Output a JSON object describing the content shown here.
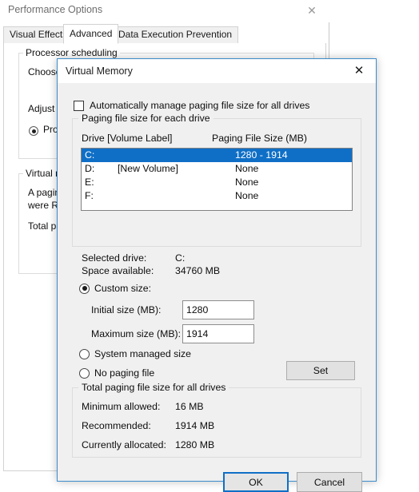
{
  "background_window": {
    "title": "Performance Options",
    "close_icon": "close-icon",
    "tabs": [
      {
        "label": "Visual Effects",
        "active": false
      },
      {
        "label": "Advanced",
        "active": true
      },
      {
        "label": "Data Execution Prevention",
        "active": false
      }
    ],
    "processor_group": {
      "title": "Processor scheduling",
      "line1": "Choose",
      "line2": "Adjust f",
      "radio_label": "Prog"
    },
    "virtual_memory_group": {
      "title": "Virtual m",
      "line1": "A pagin",
      "line2": "were RA",
      "line3": "Total pa"
    }
  },
  "dialog": {
    "title": "Virtual Memory",
    "close_icon": "close-icon",
    "auto_manage": {
      "label": "Automatically manage paging file size for all drives",
      "checked": false
    },
    "each_drive_group": {
      "title": "Paging file size for each drive",
      "columns": {
        "drive": "Drive  [Volume Label]",
        "size": "Paging File Size (MB)"
      },
      "rows": [
        {
          "drive": "C:",
          "volume_label": "",
          "size": "1280 - 1914",
          "selected": true
        },
        {
          "drive": "D:",
          "volume_label": "[New Volume]",
          "size": "None",
          "selected": false
        },
        {
          "drive": "E:",
          "volume_label": "",
          "size": "None",
          "selected": false
        },
        {
          "drive": "F:",
          "volume_label": "",
          "size": "None",
          "selected": false
        }
      ]
    },
    "selected_drive": {
      "drive_label": "Selected drive:",
      "drive_value": "C:",
      "space_label": "Space available:",
      "space_value": "34760 MB"
    },
    "size_options": {
      "custom": {
        "label": "Custom size:",
        "checked": true
      },
      "system_managed": {
        "label": "System managed size",
        "checked": false
      },
      "no_paging": {
        "label": "No paging file",
        "checked": false
      },
      "initial_label": "Initial size (MB):",
      "initial_value": "1280",
      "maximum_label": "Maximum size (MB):",
      "maximum_value": "1914",
      "set_label": "Set"
    },
    "total_group": {
      "title": "Total paging file size for all drives",
      "rows": [
        {
          "label": "Minimum allowed:",
          "value": "16 MB"
        },
        {
          "label": "Recommended:",
          "value": "1914 MB"
        },
        {
          "label": "Currently allocated:",
          "value": "1280 MB"
        }
      ]
    },
    "footer": {
      "ok_label": "OK",
      "cancel_label": "Cancel"
    }
  },
  "colors": {
    "selection_blue": "#0f6fc6",
    "dialog_border_blue": "#3c8ccb",
    "dialog_face": "#f0f0f0"
  }
}
